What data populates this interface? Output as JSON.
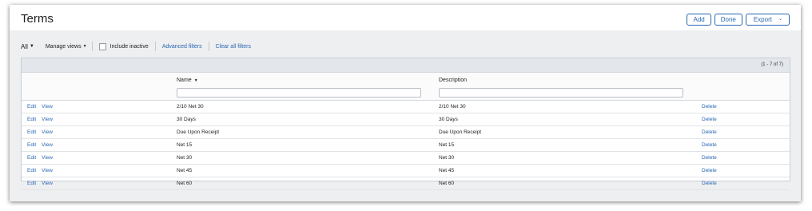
{
  "header": {
    "title": "Terms",
    "buttons": {
      "add": "Add",
      "done": "Done",
      "export": "Export"
    }
  },
  "filters": {
    "view": "All",
    "manage_views": "Manage views",
    "include_inactive": "Include inactive",
    "advanced_filters": "Advanced filters",
    "clear_all_filters": "Clear all filters"
  },
  "table": {
    "record_count": "(1 - 7 of 7)",
    "columns": {
      "name": "Name",
      "description": "Description"
    },
    "row_actions": {
      "edit": "Edit",
      "view": "View",
      "delete": "Delete"
    },
    "rows": [
      {
        "name": "2/10 Net 30",
        "description": "2/10 Net 30"
      },
      {
        "name": "30 Days",
        "description": "30 Days"
      },
      {
        "name": "Due Upon Receipt",
        "description": "Due Upon Receipt"
      },
      {
        "name": "Net 15",
        "description": "Net 15"
      },
      {
        "name": "Net 30",
        "description": "Net 30"
      },
      {
        "name": "Net 45",
        "description": "Net 45"
      },
      {
        "name": "Net 60",
        "description": "Net 60"
      }
    ]
  },
  "colors": {
    "link": "#2867b2",
    "background": "#eeeff1"
  }
}
